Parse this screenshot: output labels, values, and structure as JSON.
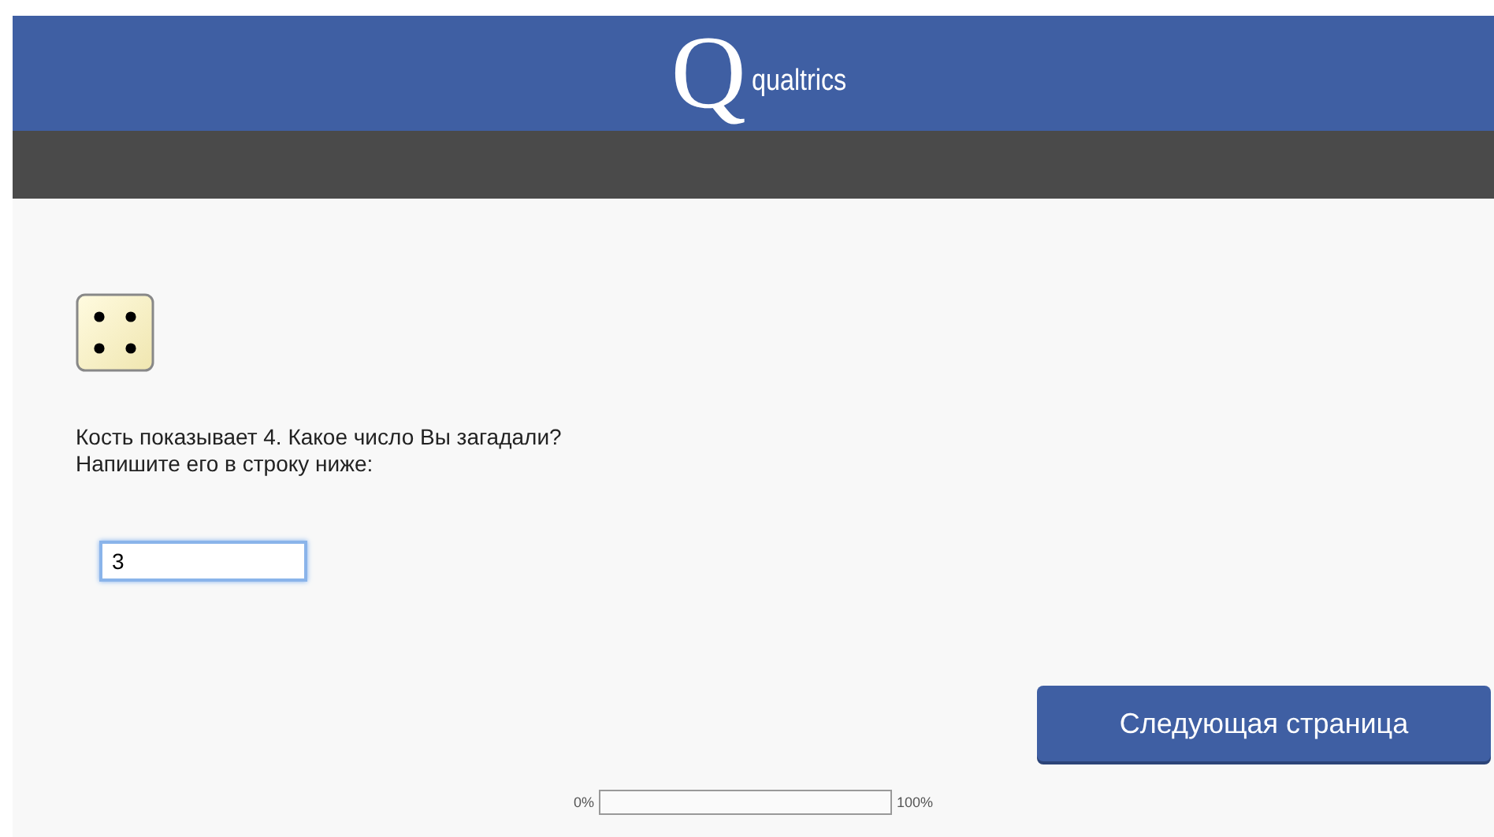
{
  "header": {
    "logo_letter": "Q",
    "logo_word": "qualtrics"
  },
  "question": {
    "text": "Кость показывает 4.  Какое число Вы загадали?",
    "hint": "Напишите его в строку ниже:",
    "answer": "3"
  },
  "next_button": "Следующая страница",
  "progress": {
    "start_label": "0%",
    "end_label": "100%",
    "level": 0
  }
}
